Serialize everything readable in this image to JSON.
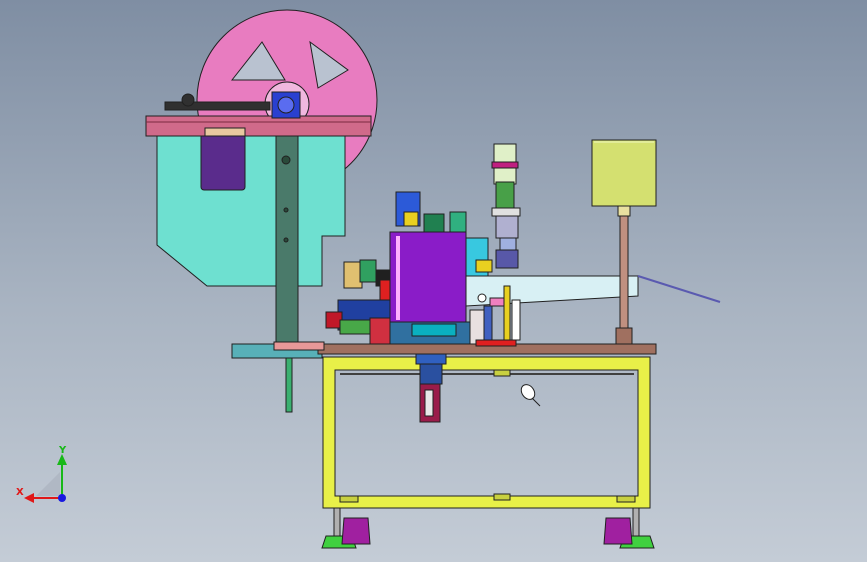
{
  "triad": {
    "x_label": "X",
    "y_label": "Y",
    "x_color": "#e01818",
    "y_color": "#18b818",
    "z_color": "#1818e0"
  },
  "colors": {
    "reel": "#e87cc0",
    "frame": "#e8f048",
    "cover": "#6ee0d0",
    "motor": "#d4e070",
    "press_block": "#8a1cc8",
    "arm": "#d8f0f4",
    "top_plate": "#d06a8a"
  }
}
